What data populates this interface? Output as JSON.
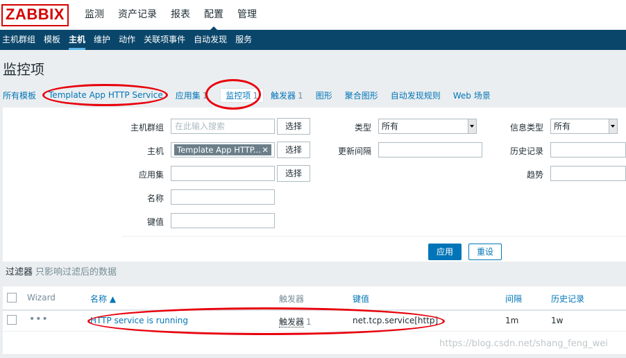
{
  "app": {
    "logo": "ZABBIX"
  },
  "main_menu": [
    "监测",
    "资产记录",
    "报表",
    "配置",
    "管理"
  ],
  "main_menu_active": "配置",
  "sub_menu": [
    "主机群组",
    "模板",
    "主机",
    "维护",
    "动作",
    "关联项事件",
    "自动发现",
    "服务"
  ],
  "sub_menu_active": "主机",
  "page_title": "监控项",
  "breadcrumbs": {
    "all_templates": "所有模板",
    "template": "Template App HTTP Service",
    "applications": "应用集",
    "applications_count": "1",
    "items": "监控项",
    "items_count": "1",
    "triggers": "触发器",
    "triggers_count": "1",
    "graphs": "图形",
    "screens": "聚合图形",
    "discovery": "自动发现规则",
    "web": "Web 场景"
  },
  "filter": {
    "host_group_label": "主机群组",
    "host_group_placeholder": "在此输入搜索",
    "select_label": "选择",
    "host_label": "主机",
    "host_value": "Template App HTTP...",
    "application_label": "应用集",
    "name_label": "名称",
    "key_label": "键值",
    "type_label": "类型",
    "type_value": "所有",
    "update_interval_label": "更新间隔",
    "info_type_label": "信息类型",
    "info_type_value": "所有",
    "history_label": "历史记录",
    "trends_label": "趋势",
    "apply_label": "应用",
    "reset_label": "重设",
    "caption": "过滤器",
    "caption_sub": "只影响过滤后的数据"
  },
  "table": {
    "headers": {
      "wizard": "Wizard",
      "name": "名称 ▲",
      "triggers": "触发器",
      "key": "键值",
      "interval": "间隔",
      "history": "历史记录"
    },
    "rows": [
      {
        "wizard": "•••",
        "name": "HTTP service is running",
        "triggers": "触发器",
        "triggers_count": "1",
        "key": "net.tcp.service[http]",
        "interval": "1m",
        "history": "1w"
      }
    ]
  },
  "watermark": "https://blog.csdn.net/shang_feng_wei",
  "colors": {
    "nav_bg": "#0a466a",
    "link": "#0275b8",
    "annotation": "#e8000c",
    "logo": "#d40000"
  }
}
